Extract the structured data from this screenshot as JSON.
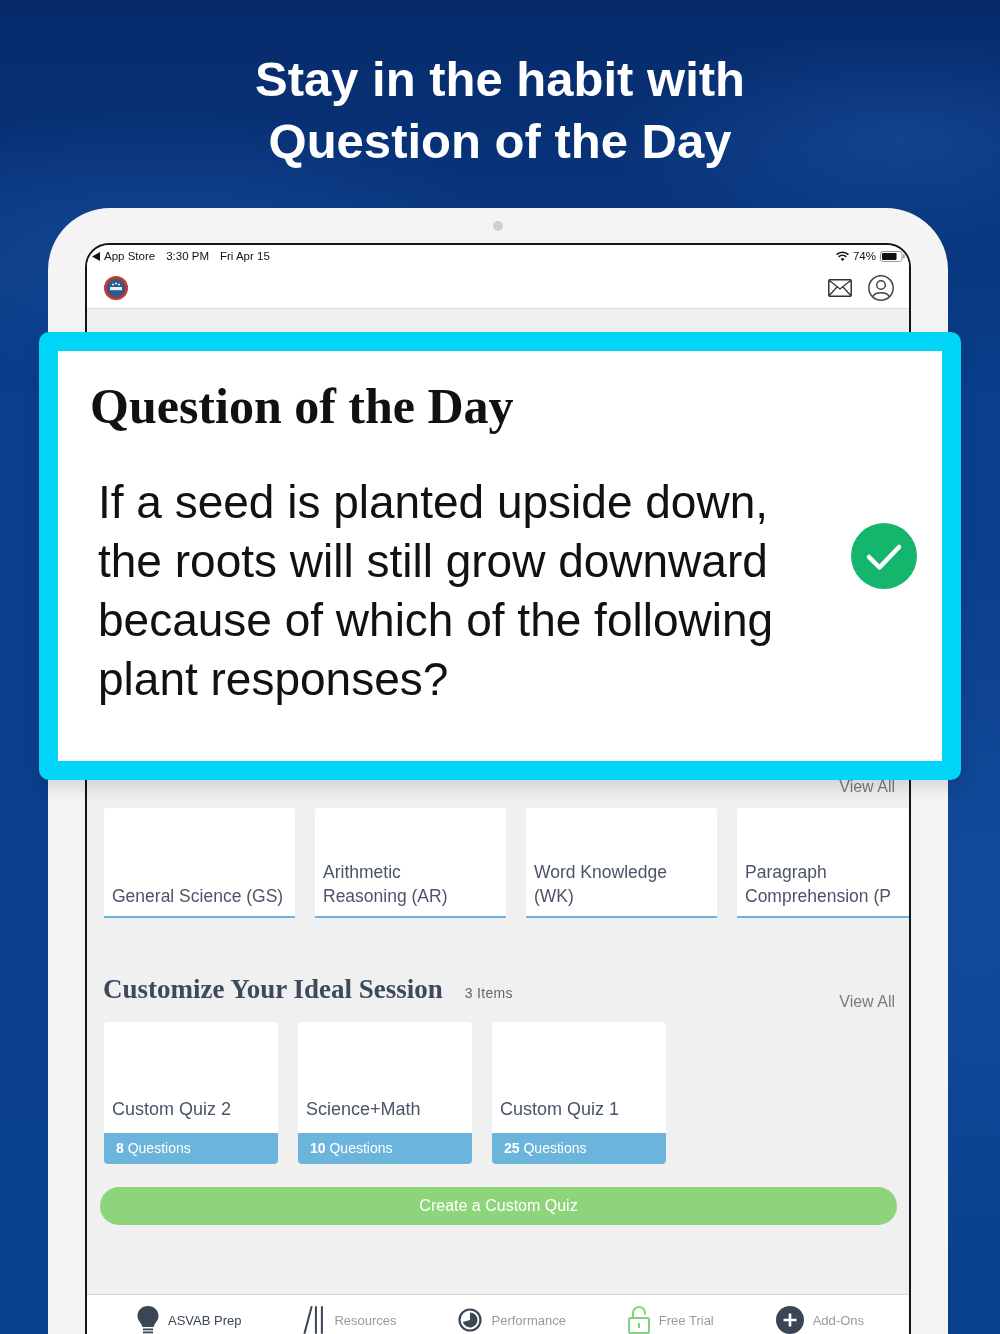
{
  "headline": "Stay in the habit with\nQuestion of the Day",
  "status_bar": {
    "back_label": "App Store",
    "time": "3:30 PM",
    "date": "Fri Apr 15",
    "battery": "74%"
  },
  "question_card": {
    "title": "Question of the Day",
    "question": "If a seed is planted upside down, the roots will still grow downward because of which of the following plant responses?",
    "answered": true
  },
  "subjects": {
    "view_all": "View All",
    "items": [
      {
        "name": "General Science (GS)"
      },
      {
        "name": "Arithmetic\nReasoning (AR)"
      },
      {
        "name": "Word Knowledge\n(WK)"
      },
      {
        "name": "Paragraph\nComprehension (P"
      }
    ]
  },
  "custom_quizzes": {
    "title": "Customize Your Ideal Session",
    "count": "3 Items",
    "view_all": "View All",
    "items": [
      {
        "name": "Custom Quiz 2",
        "questions": "**8** Questions"
      },
      {
        "name": "Science+Math",
        "questions": "**10** Questions"
      },
      {
        "name": "Custom Quiz 1",
        "questions": "**25** Questions"
      }
    ],
    "create_button": "Create a Custom Quiz"
  },
  "tab_bar": [
    {
      "label": "ASVAB Prep",
      "selected": true
    },
    {
      "label": "Resources",
      "selected": false
    },
    {
      "label": "Performance",
      "selected": false
    },
    {
      "label": "Free Trial",
      "selected": false
    },
    {
      "label": "Add-Ons",
      "selected": false
    }
  ]
}
